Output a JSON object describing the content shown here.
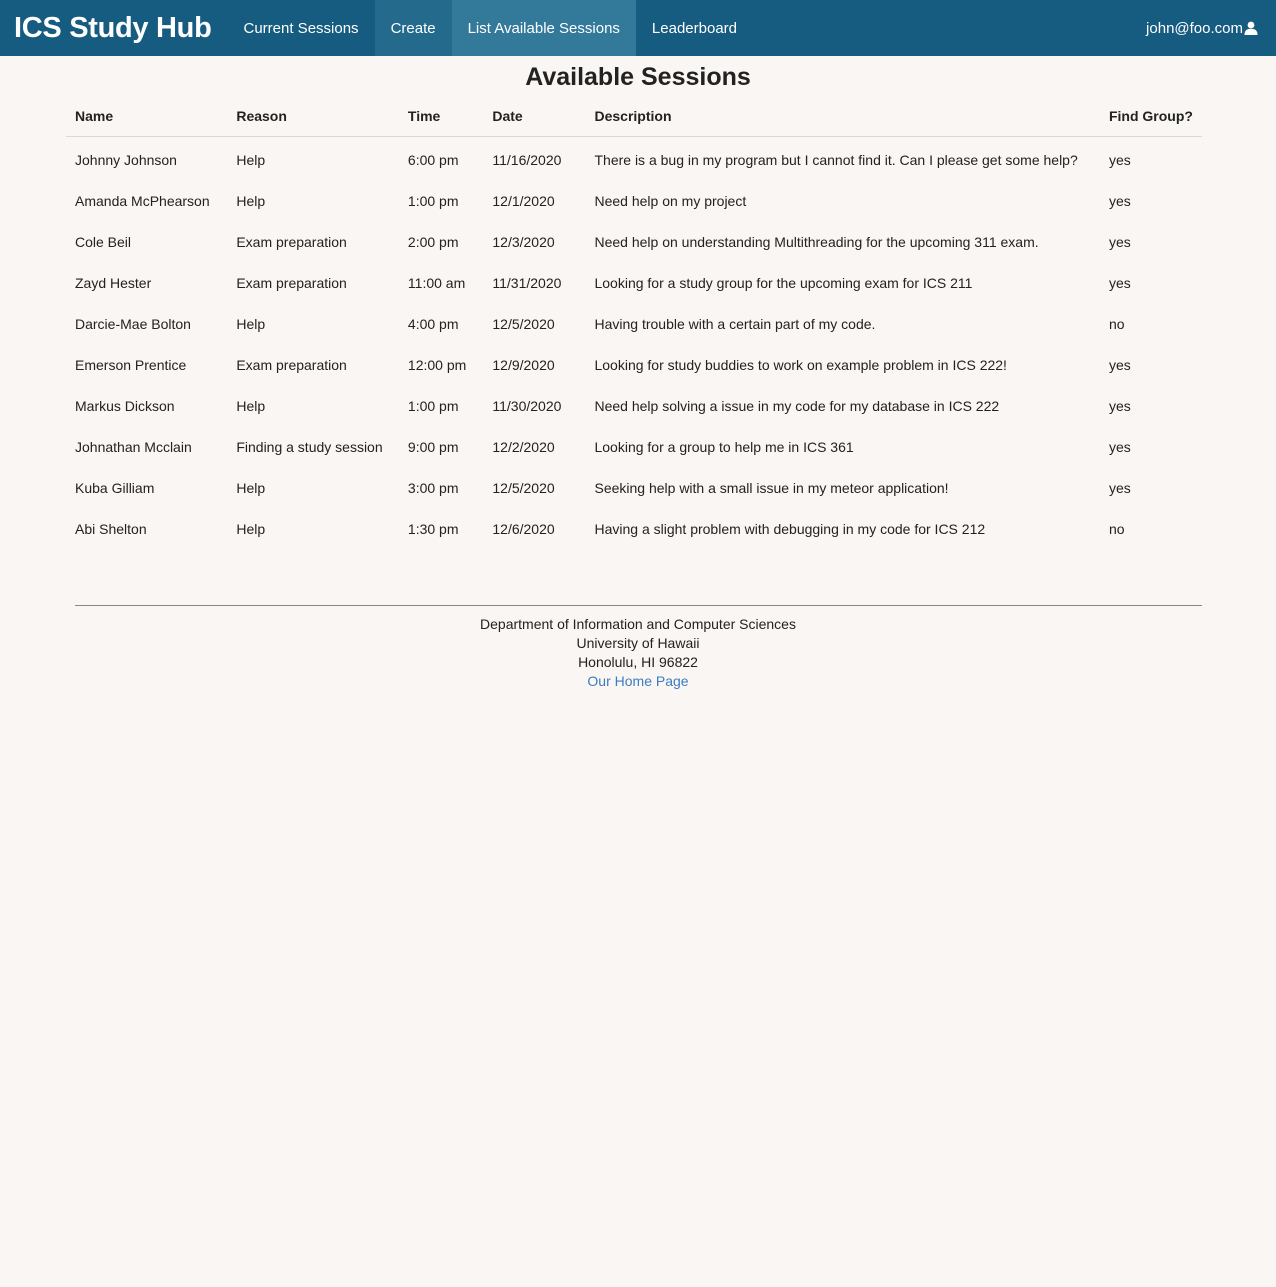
{
  "navbar": {
    "brand": "ICS Study Hub",
    "items": [
      {
        "label": "Current Sessions"
      },
      {
        "label": "Create"
      },
      {
        "label": "List Available Sessions"
      },
      {
        "label": "Leaderboard"
      }
    ],
    "user_email": "john@foo.com",
    "user_icon": "user-icon",
    "bar_color": "#165b80"
  },
  "main": {
    "title": "Available Sessions",
    "columns": [
      "Name",
      "Reason",
      "Time",
      "Date",
      "Description",
      "Find Group?"
    ],
    "rows": [
      [
        "Johnny Johnson",
        "Help",
        "6:00 pm",
        "11/16/2020",
        "There is a bug in my program but I cannot find it. Can I please get some help?",
        "yes"
      ],
      [
        "Amanda McPhearson",
        "Help",
        "1:00 pm",
        "12/1/2020",
        "Need help on my project",
        "yes"
      ],
      [
        "Cole Beil",
        "Exam preparation",
        "2:00 pm",
        "12/3/2020",
        "Need help on understanding Multithreading for the upcoming 311 exam.",
        "yes"
      ],
      [
        "Zayd Hester",
        "Exam preparation",
        "11:00 am",
        "11/31/2020",
        "Looking for a study group for the upcoming exam for ICS 211",
        "yes"
      ],
      [
        "Darcie-Mae Bolton",
        "Help",
        "4:00 pm",
        "12/5/2020",
        "Having trouble with a certain part of my code.",
        "no"
      ],
      [
        "Emerson Prentice",
        "Exam preparation",
        "12:00 pm",
        "12/9/2020",
        "Looking for study buddies to work on example problem in ICS 222!",
        "yes"
      ],
      [
        "Markus Dickson",
        "Help",
        "1:00 pm",
        "11/30/2020",
        "Need help solving a issue in my code for my database in ICS 222",
        "yes"
      ],
      [
        "Johnathan Mcclain",
        "Finding a study session",
        "9:00 pm",
        "12/2/2020",
        "Looking for a group to help me in ICS 361",
        "yes"
      ],
      [
        "Kuba Gilliam",
        "Help",
        "3:00 pm",
        "12/5/2020",
        "Seeking help with a small issue in my meteor application!",
        "yes"
      ],
      [
        "Abi Shelton",
        "Help",
        "1:30 pm",
        "12/6/2020",
        "Having a slight problem with debugging in my code for ICS 212",
        "no"
      ]
    ]
  },
  "footer": {
    "line1": "Department of Information and Computer Sciences",
    "line2": "University of Hawaii",
    "line3": "Honolulu, HI 96822",
    "link": "Our Home Page"
  }
}
